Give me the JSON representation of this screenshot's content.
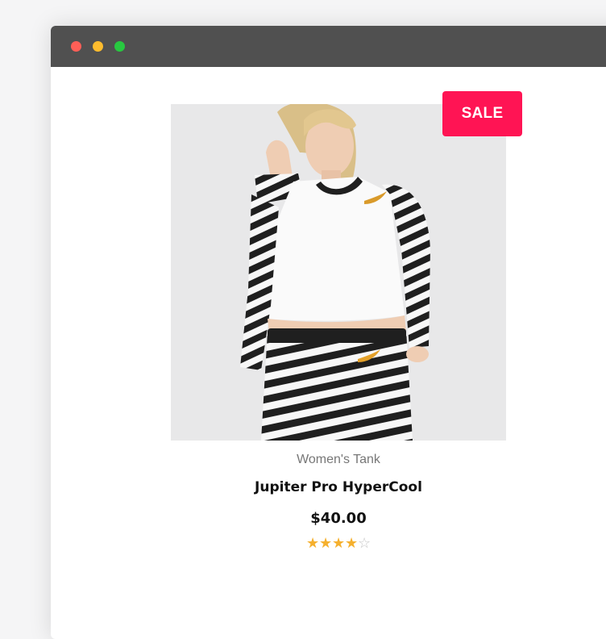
{
  "window": {
    "controls": [
      "close",
      "minimize",
      "maximize"
    ]
  },
  "product": {
    "badge": "SALE",
    "category": "Women's Tank",
    "title": "Jupiter Pro HyperCool",
    "price": "$40.00",
    "rating": 4,
    "rating_max": 5,
    "image_icon": "product-photo"
  },
  "colors": {
    "badge": "#ff1454",
    "star": "#f5b02e",
    "titlebar": "#505050"
  }
}
